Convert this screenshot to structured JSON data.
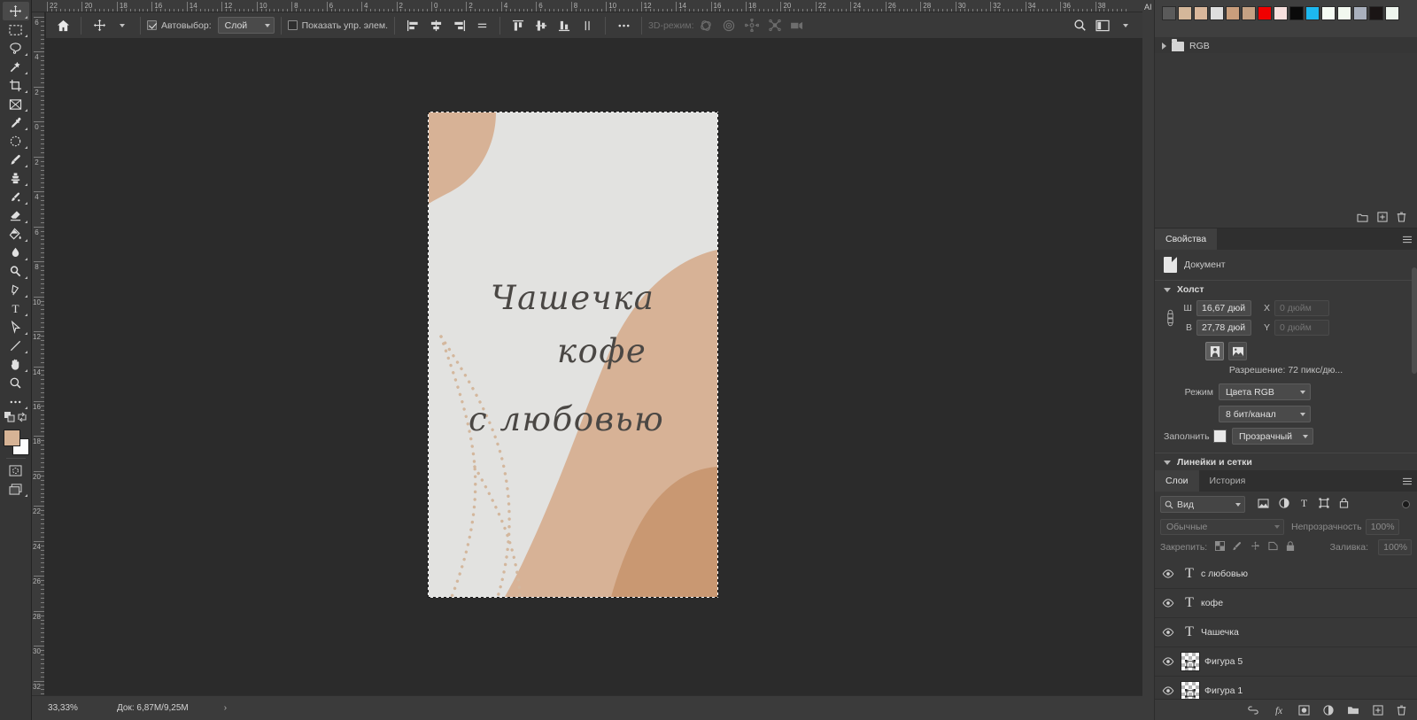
{
  "options_bar": {
    "home_icon": "home-icon",
    "tool_icon": "move-tool-icon",
    "auto_select_label": "Автовыбор:",
    "auto_select_checked": true,
    "auto_select_value": "Слой",
    "show_controls_label": "Показать упр. элем.",
    "show_controls_checked": false,
    "more_label": "•••",
    "mode_3d_label": "3D-режим:",
    "search_icon": "search-icon",
    "workspace_icon": "workspace-icon",
    "align_icons": [
      "align-left-edges-icon",
      "align-horizontal-centers-icon",
      "align-right-edges-icon",
      "distribute-horizontal-icon",
      "align-top-edges-icon",
      "align-vertical-centers-icon",
      "align-bottom-edges-icon",
      "distribute-vertical-icon"
    ],
    "mode3d_icons": [
      "orbit-3d-icon",
      "roll-3d-icon",
      "pan-3d-icon",
      "slide-3d-icon",
      "scale-3d-icon"
    ]
  },
  "toolbar": {
    "tools": [
      {
        "name": "move-tool",
        "glyph": "move",
        "selected": true
      },
      {
        "name": "rectangular-marquee-tool",
        "glyph": "marquee",
        "selected": false
      },
      {
        "name": "lasso-tool",
        "glyph": "lasso",
        "selected": false
      },
      {
        "name": "magic-wand-tool",
        "glyph": "wand",
        "selected": false
      },
      {
        "name": "crop-tool",
        "glyph": "crop",
        "selected": false
      },
      {
        "name": "frame-tool",
        "glyph": "frame",
        "selected": false
      },
      {
        "name": "eyedropper-tool",
        "glyph": "eyedropper",
        "selected": false
      },
      {
        "name": "spot-healing-brush-tool",
        "glyph": "healing",
        "selected": false
      },
      {
        "name": "brush-tool",
        "glyph": "brush",
        "selected": false
      },
      {
        "name": "clone-stamp-tool",
        "glyph": "stamp",
        "selected": false
      },
      {
        "name": "history-brush-tool",
        "glyph": "historybrush",
        "selected": false
      },
      {
        "name": "eraser-tool",
        "glyph": "eraser",
        "selected": false
      },
      {
        "name": "gradient-tool",
        "glyph": "paintbucket",
        "selected": false
      },
      {
        "name": "blur-tool",
        "glyph": "blur",
        "selected": false
      },
      {
        "name": "dodge-tool",
        "glyph": "dodge",
        "selected": false
      },
      {
        "name": "pen-tool",
        "glyph": "pen",
        "selected": false
      },
      {
        "name": "horizontal-type-tool",
        "glyph": "type",
        "selected": false
      },
      {
        "name": "path-selection-tool",
        "glyph": "pathselect",
        "selected": false
      },
      {
        "name": "line-tool",
        "glyph": "line",
        "selected": false
      },
      {
        "name": "hand-tool",
        "glyph": "hand",
        "selected": false
      },
      {
        "name": "zoom-tool",
        "glyph": "zoom",
        "selected": false
      },
      {
        "name": "edit-toolbar",
        "glyph": "ellipsis",
        "selected": false
      }
    ],
    "foreground_color": "#d6b395",
    "background_color": "#fdfdfd"
  },
  "rulers": {
    "unit": "inches",
    "horizontal_labels": [
      "22",
      "20",
      "18",
      "16",
      "14",
      "12",
      "10",
      "8",
      "6",
      "4",
      "2",
      "0",
      "2",
      "4",
      "6",
      "8",
      "10",
      "12",
      "14",
      "16",
      "18",
      "20",
      "22",
      "24",
      "26",
      "28",
      "30",
      "32",
      "34",
      "36",
      "38"
    ],
    "vertical_labels": [
      "6",
      "4",
      "2",
      "0",
      "2",
      "4",
      "6",
      "8",
      "10",
      "12",
      "14",
      "16",
      "18",
      "20",
      "22",
      "24",
      "26",
      "28",
      "30",
      "32"
    ]
  },
  "canvas": {
    "artwork": {
      "background_color": "#e2e2e0",
      "shape_tan": "#d7b296",
      "shape_tan_dark": "#c99872",
      "dot_color": "#d3b79d",
      "text_color": "#4a4744",
      "lines": [
        {
          "text": "Чашечка",
          "name": "artwork-text-line-1"
        },
        {
          "text": "кофе",
          "name": "artwork-text-line-2"
        },
        {
          "text": "с любовью",
          "name": "artwork-text-line-3"
        }
      ]
    }
  },
  "status_bar": {
    "zoom": "33,33%",
    "doc_info": "Док: 6,87M/9,25M",
    "expand_icon": "chevron-right-icon"
  },
  "right_rail": {
    "label": "AI"
  },
  "swatches_panel": {
    "name": "swatches-panel",
    "colors": [
      "#5a5a5a",
      "#d4b79a",
      "#d9b79b",
      "#dedede",
      "#c99e7c",
      "#c4a183",
      "#f00000",
      "#f6dfdd",
      "#0a0a0a",
      "#1db8ef",
      "#f5fbf3",
      "#f2f8ef",
      "#a9b0bd",
      "#1a1515",
      "#eef5ee"
    ],
    "group_label": "RGB",
    "footer_icons": [
      "new-group-icon",
      "new-swatch-icon",
      "delete-icon"
    ]
  },
  "properties_panel": {
    "tab_label": "Свойства",
    "doc_label": "Документ",
    "sections": {
      "canvas": {
        "title": "Холст",
        "width_label": "Ш",
        "width_value": "16,67 дюй",
        "height_label": "В",
        "height_value": "27,78 дюй",
        "x_label": "X",
        "x_placeholder": "0 дюйм",
        "y_label": "Y",
        "y_placeholder": "0 дюйм",
        "orientation_portrait": "portrait-icon",
        "orientation_landscape": "landscape-icon",
        "resolution_text": "Разрешение: 72 пикс/дю...",
        "mode_label": "Режим",
        "mode_value": "Цвета RGB",
        "depth_value": "8 бит/канал",
        "fill_label": "Заполнить",
        "fill_value": "Прозрачный"
      },
      "rulers": {
        "title": "Линейки и сетки"
      }
    }
  },
  "layers_panel": {
    "tabs": [
      {
        "label": "Слои",
        "active": true,
        "name": "tab-layers"
      },
      {
        "label": "История",
        "active": false,
        "name": "tab-history"
      }
    ],
    "filter": {
      "icon": "search-icon",
      "value": "Вид"
    },
    "filter_type_icons": [
      "filter-image-icon",
      "filter-adjustment-icon",
      "filter-type-icon",
      "filter-shape-icon",
      "filter-smart-object-icon"
    ],
    "blend_mode": "Обычные",
    "opacity_label": "Непрозрачность",
    "opacity_value": "100%",
    "lock_label": "Закрепить:",
    "lock_icons": [
      "lock-transparent-pixels-icon",
      "lock-image-pixels-icon",
      "lock-position-icon",
      "lock-artboard-icon",
      "lock-all-icon"
    ],
    "fill_label": "Заливка:",
    "fill_value": "100%",
    "layers": [
      {
        "name": "с любовью",
        "type": "text",
        "visible": true
      },
      {
        "name": "кофе",
        "type": "text",
        "visible": true
      },
      {
        "name": "Чашечка",
        "type": "text",
        "visible": true
      },
      {
        "name": "Фигура 5",
        "type": "shape",
        "visible": true
      },
      {
        "name": "Фигура 1",
        "type": "shape",
        "visible": true
      }
    ],
    "footer_icons": [
      "link-layers-icon",
      "layer-style-fx-icon",
      "layer-mask-icon",
      "adjustment-layer-icon",
      "new-group-icon",
      "new-layer-icon",
      "delete-layer-icon"
    ]
  }
}
